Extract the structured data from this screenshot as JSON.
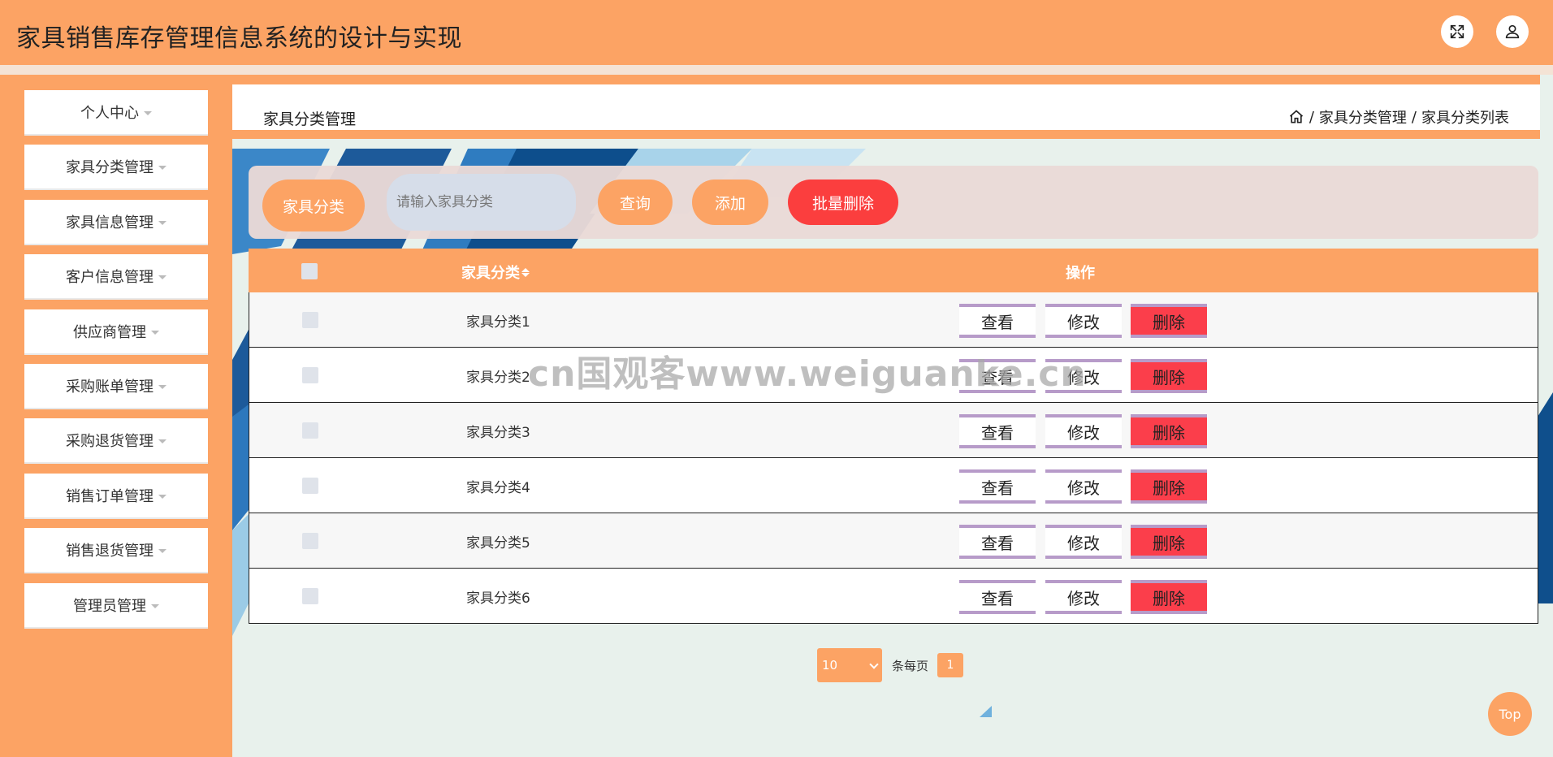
{
  "app": {
    "title": "家具销售库存管理信息系统的设计与实现"
  },
  "header": {
    "fullscreen_icon": "expand-icon",
    "user_icon": "user-icon"
  },
  "sidebar": {
    "items": [
      {
        "label": "个人中心"
      },
      {
        "label": "家具分类管理"
      },
      {
        "label": "家具信息管理"
      },
      {
        "label": "客户信息管理"
      },
      {
        "label": "供应商管理"
      },
      {
        "label": "采购账单管理"
      },
      {
        "label": "采购退货管理"
      },
      {
        "label": "销售订单管理"
      },
      {
        "label": "销售退货管理"
      },
      {
        "label": "管理员管理"
      }
    ]
  },
  "breadcrumb": {
    "page_title": "家具分类管理",
    "home_icon": "home-icon",
    "separator": "/",
    "level1": "家具分类管理",
    "level2": "家具分类列表"
  },
  "search": {
    "label": "家具分类",
    "placeholder": "请输入家具分类",
    "query_button": "查询",
    "add_button": "添加",
    "batch_delete_button": "批量删除"
  },
  "table": {
    "headers": {
      "name": "家具分类",
      "ops": "操作"
    },
    "rows": [
      {
        "name": "家具分类1"
      },
      {
        "name": "家具分类2"
      },
      {
        "name": "家具分类3"
      },
      {
        "name": "家具分类4"
      },
      {
        "name": "家具分类5"
      },
      {
        "name": "家具分类6"
      }
    ],
    "actions": {
      "view": "查看",
      "edit": "修改",
      "delete": "删除"
    }
  },
  "pagination": {
    "page_size": "10",
    "per_page_label": "条每页",
    "current_page": "1"
  },
  "watermark": "cn国观客www.weiguanke.cn",
  "top_button": "Top",
  "colors": {
    "primary": "#fca364",
    "danger": "#fb3e4b",
    "row_border": "#b79bc9"
  }
}
